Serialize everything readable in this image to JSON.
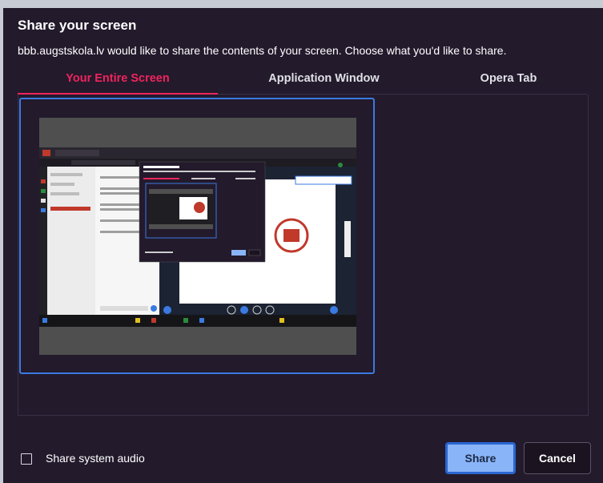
{
  "dialog": {
    "title": "Share your screen",
    "subtitle": "bbb.augstskola.lv would like to share the contents of your screen. Choose what you'd like to share."
  },
  "tabs": [
    {
      "label": "Your Entire Screen",
      "active": true
    },
    {
      "label": "Application Window",
      "active": false
    },
    {
      "label": "Opera Tab",
      "active": false
    }
  ],
  "footer": {
    "audio_label": "Share system audio",
    "audio_checked": false,
    "share_label": "Share",
    "cancel_label": "Cancel"
  },
  "colors": {
    "background": "#231a2c",
    "accent": "#f0245c",
    "selection": "#3b7ae0",
    "share_button": "#8ab4f8"
  }
}
